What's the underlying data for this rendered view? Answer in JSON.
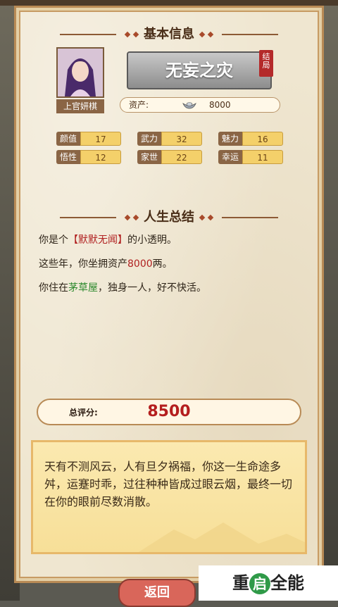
{
  "basic_info": {
    "title": "基本信息",
    "avatar_name": "上官妍棋",
    "ending": "无妄之灾",
    "ending_tag": "结局",
    "assets_label": "资产:",
    "assets_value": "8000",
    "stats": [
      {
        "label": "颜值",
        "value": "17"
      },
      {
        "label": "武力",
        "value": "32"
      },
      {
        "label": "魅力",
        "value": "16"
      },
      {
        "label": "悟性",
        "value": "12"
      },
      {
        "label": "家世",
        "value": "22"
      },
      {
        "label": "幸运",
        "value": "11"
      }
    ]
  },
  "life_summary": {
    "title": "人生总结",
    "line1_a": "你是个",
    "line1_b": "【默默无闻】",
    "line1_c": "的小透明。",
    "line2_a": "这些年，你坐拥资产",
    "line2_b": "8000",
    "line2_c": "两。",
    "line3_a": "你住在",
    "line3_b": "茅草屋",
    "line3_c": "，独身一人，好不快活。"
  },
  "score": {
    "label": "总评分:",
    "value": "8500"
  },
  "verse": "天有不测风云，人有旦夕祸福，你这一生命途多舛，运蹇时乖，过往种种皆成过眼云烟，最终一切在你的眼前尽数消散。",
  "buttons": {
    "back": "返回"
  },
  "watermark": {
    "left": "重",
    "mid": "启",
    "right": "全能"
  },
  "colors": {
    "paper": "#efe6d0",
    "accent_red": "#b02020",
    "accent_green": "#2f8a2f",
    "stat_value_bg": "#f4d06a"
  }
}
